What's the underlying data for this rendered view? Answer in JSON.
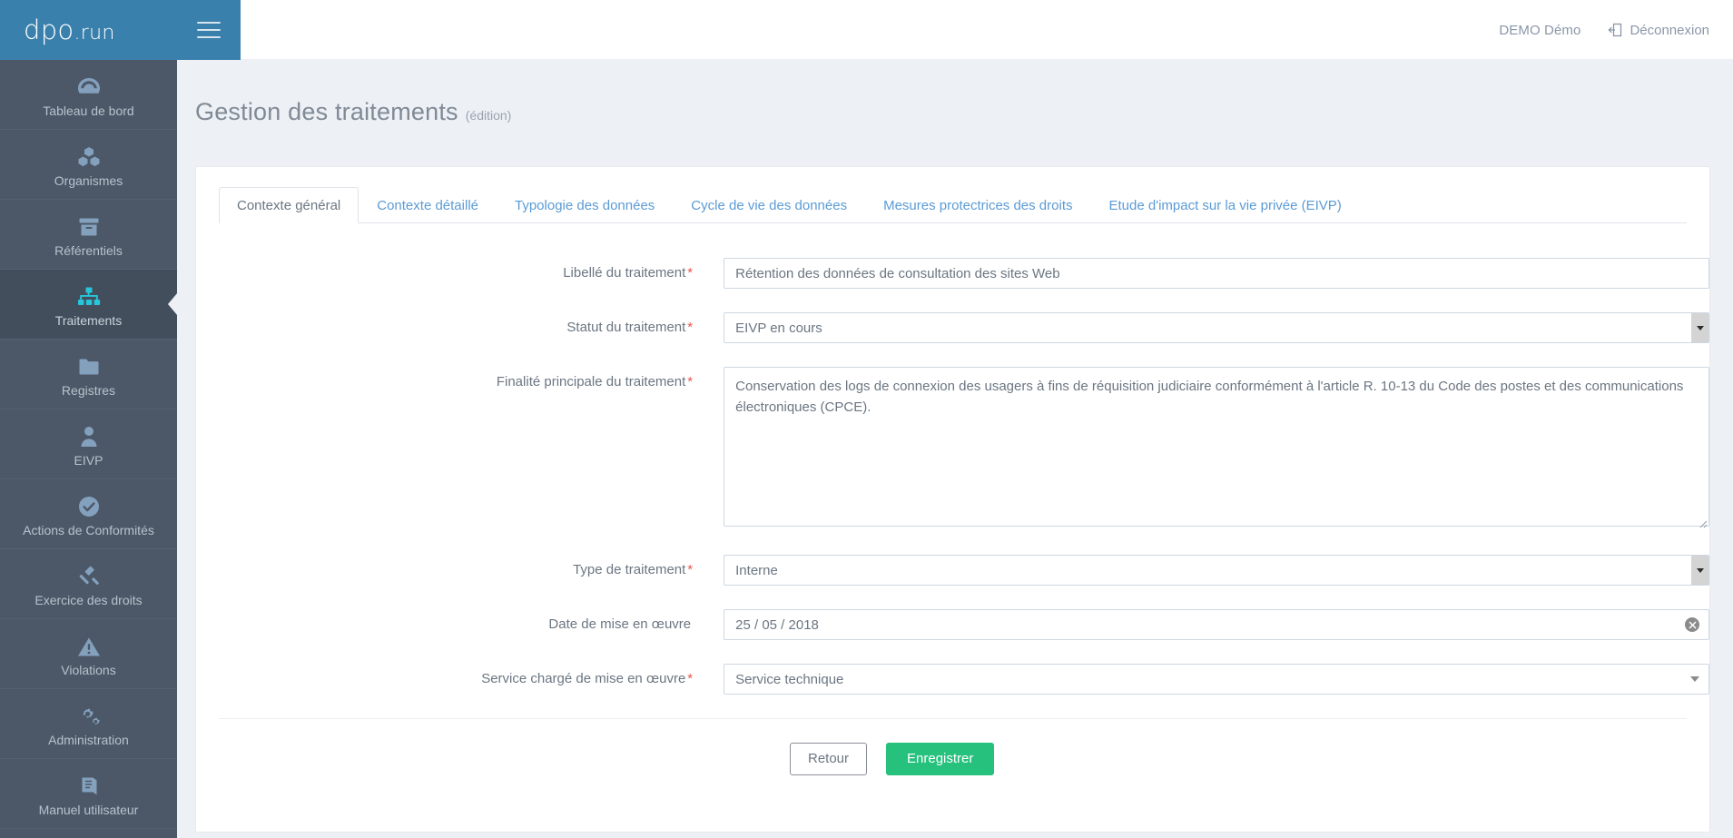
{
  "brand": {
    "name": "dpo",
    "suffix": ".run",
    "menu_icon": "hamburger-icon"
  },
  "topbar": {
    "user_name": "DEMO Démo",
    "logout_label": "Déconnexion",
    "logout_icon": "logout-icon"
  },
  "sidebar": {
    "items": [
      {
        "label": "Tableau de bord",
        "icon": "dashboard-icon",
        "active": false
      },
      {
        "label": "Organismes",
        "icon": "boxes-icon",
        "active": false
      },
      {
        "label": "Référentiels",
        "icon": "archive-icon",
        "active": false
      },
      {
        "label": "Traitements",
        "icon": "sitemap-icon",
        "active": true
      },
      {
        "label": "Registres",
        "icon": "folder-icon",
        "active": false
      },
      {
        "label": "EIVP",
        "icon": "user-icon",
        "active": false
      },
      {
        "label": "Actions de Conformités",
        "icon": "check-circle-icon",
        "active": false
      },
      {
        "label": "Exercice des droits",
        "icon": "gavel-icon",
        "active": false
      },
      {
        "label": "Violations",
        "icon": "warning-icon",
        "active": false
      },
      {
        "label": "Administration",
        "icon": "gears-icon",
        "active": false
      },
      {
        "label": "Manuel utilisateur",
        "icon": "book-icon",
        "active": false
      }
    ]
  },
  "page": {
    "title": "Gestion des traitements",
    "subtitle": "(édition)"
  },
  "tabs": [
    {
      "label": "Contexte général",
      "active": true
    },
    {
      "label": "Contexte détaillé",
      "active": false
    },
    {
      "label": "Typologie des données",
      "active": false
    },
    {
      "label": "Cycle de vie des données",
      "active": false
    },
    {
      "label": "Mesures protectrices des droits",
      "active": false
    },
    {
      "label": "Etude d'impact sur la vie privée (EIVP)",
      "active": false
    }
  ],
  "form": {
    "libelle": {
      "label": "Libellé du traitement",
      "required": "*",
      "value": "Rétention des données de consultation des sites Web",
      "placeholder": ""
    },
    "statut": {
      "label": "Statut du traitement",
      "required": "*",
      "value": "EIVP en cours"
    },
    "finalite": {
      "label": "Finalité principale du traitement",
      "required": "*",
      "value": "Conservation des logs de connexion des usagers à fins de réquisition judiciaire conformément à l'article R. 10-13 du Code des postes et des communications électroniques (CPCE).",
      "placeholder": ""
    },
    "type": {
      "label": "Type de traitement",
      "required": "*",
      "value": "Interne"
    },
    "date_mise_en_oeuvre": {
      "label": "Date de mise en œuvre",
      "required": "",
      "value": "25 / 05 / 2018",
      "clear_icon": "clear-circle-icon"
    },
    "service": {
      "label": "Service chargé de mise en œuvre",
      "required": "*",
      "value": "Service technique",
      "arrow_icon": "chevron-down-icon"
    }
  },
  "actions": {
    "back_label": "Retour",
    "save_label": "Enregistrer"
  },
  "colors": {
    "brand_blue": "#3a80ac",
    "sidebar_bg": "#4c5868",
    "sidebar_active_bg": "#434e5c",
    "active_icon": "#26c6da",
    "tab_link": "#5b9bd5",
    "required_red": "#e8554e",
    "save_green": "#27c17e",
    "page_bg": "#edf0f5"
  }
}
